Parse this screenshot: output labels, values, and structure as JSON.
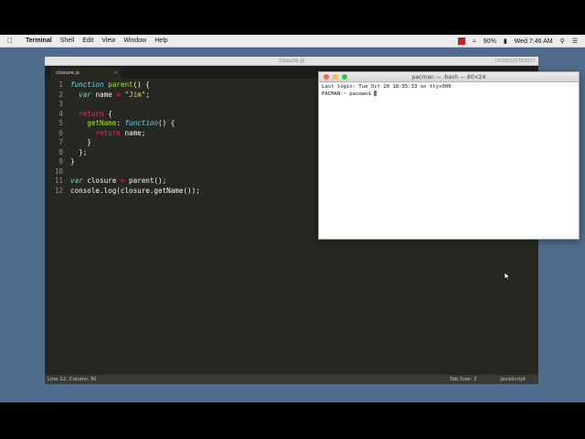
{
  "menubar": {
    "app": "Terminal",
    "items": [
      "Shell",
      "Edit",
      "View",
      "Window",
      "Help"
    ],
    "status": {
      "battery": "90%",
      "clock": "Wed 7:46 AM"
    }
  },
  "editor": {
    "window_title": "closure.js",
    "unregistered": "UNREGISTERED",
    "tab_label": "closure.js",
    "line_numbers": [
      "1",
      "2",
      "3",
      "4",
      "5",
      "6",
      "7",
      "8",
      "9",
      "10",
      "11",
      "12"
    ],
    "status": {
      "position": "Line 12, Column 30",
      "tab_size": "Tab Size: 2",
      "syntax": "JavaScript"
    }
  },
  "terminal": {
    "title": "pacman — -bash — 80×24",
    "lines": [
      "Last login: Tue Oct 20 18:35:33 on ttys000",
      "PACMAN:~ pacman$ "
    ]
  },
  "colors": {
    "desktop": "#4f6b8d",
    "editor_bg": "#272822",
    "keyword": "#f92672",
    "storage": "#66d9ef",
    "function": "#a6e22e",
    "string": "#e6db74"
  }
}
